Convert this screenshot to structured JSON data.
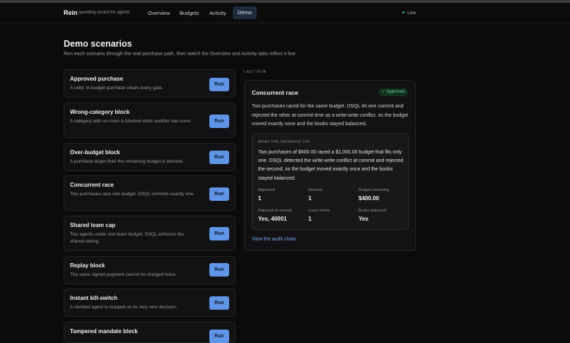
{
  "nav": {
    "brand": "Rein",
    "tagline": "spending control for agents",
    "links": [
      "Overview",
      "Budgets",
      "Activity",
      "Demo"
    ],
    "status": "Live"
  },
  "header": {
    "title": "Demo scenarios",
    "subtitle": "Run each scenario through the real purchase path, then watch the Overview and Activity tabs reflect it live."
  },
  "scenarios": [
    {
      "title": "Approved purchase",
      "desc": "A valid, in-budget purchase clears every gate.",
      "button": "Run"
    },
    {
      "title": "Wrong-category block",
      "desc": "A category with no room is blocked while another has room.",
      "button": "Run"
    },
    {
      "title": "Over-budget block",
      "desc": "A purchase larger than the remaining budget is blocked.",
      "button": "Run"
    },
    {
      "title": "Concurrent race",
      "desc": "Two purchases race one budget. DSQL commits exactly one.",
      "button": "Run"
    },
    {
      "title": "Shared team cap",
      "desc": "Two agents under one team budget. DSQL enforces the shared ceiling.",
      "button": "Run"
    },
    {
      "title": "Replay block",
      "desc": "The same signed payment cannot be charged twice.",
      "button": "Run"
    },
    {
      "title": "Instant kill-switch",
      "desc": "A revoked agent is stopped on its very next decision.",
      "button": "Run"
    },
    {
      "title": "Tampered mandate block",
      "desc": "",
      "button": "Run"
    }
  ],
  "last_run": {
    "section_label": "LAST RUN",
    "title": "Concurrent race",
    "badge": "Approved",
    "badge_icon": "check-icon",
    "description": "Two purchases raced for the same budget. DSQL let one commit and rejected the other at commit time as a write-write conflict, so the budget moved exactly once and the books stayed balanced.",
    "db_label": "WHAT THE DATABASE DID",
    "db_description": "Two purchases of $600.00 raced a $1,000.00 budget that fits only one. DSQL detected the write-write conflict at commit and rejected the second, so the budget moved exactly once and the books stayed balanced.",
    "stats": [
      {
        "label": "Approved",
        "value": "1"
      },
      {
        "label": "Blocked",
        "value": "1"
      },
      {
        "label": "Budget remaining",
        "value": "$400.00"
      },
      {
        "label": "Rejected at commit",
        "value": "Yes, 40001"
      },
      {
        "label": "Loser retries",
        "value": "1"
      },
      {
        "label": "Books balanced",
        "value": "Yes"
      }
    ],
    "audit_link": "View the audit chain"
  },
  "colors": {
    "accent": "#5f94e6",
    "success": "#6fd79b",
    "live_dot": "#2bb673",
    "background": "#0b0b0c"
  }
}
